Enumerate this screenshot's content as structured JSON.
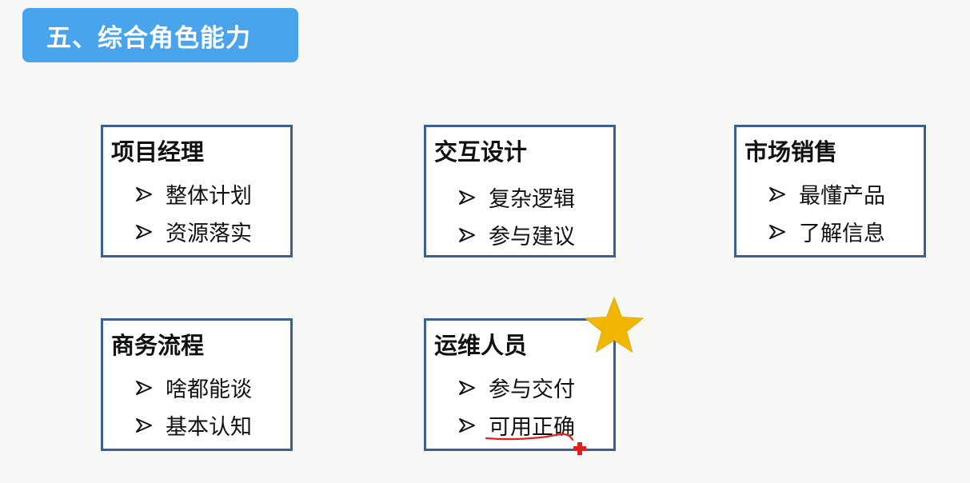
{
  "title": "五、综合角色能力",
  "cards": [
    {
      "title": "项目经理",
      "items": [
        "整体计划",
        "资源落实"
      ]
    },
    {
      "title": "交互设计",
      "items": [
        "复杂逻辑",
        "参与建议"
      ]
    },
    {
      "title": "市场销售",
      "items": [
        "最懂产品",
        "了解信息"
      ]
    },
    {
      "title": "商务流程",
      "items": [
        "啥都能谈",
        "基本认知"
      ]
    },
    {
      "title": "运维人员",
      "items": [
        "参与交付",
        "可用正确"
      ]
    }
  ],
  "colors": {
    "banner": "#4aa4ec",
    "card_border": "#3c5f92",
    "star": "#f2b705",
    "annotation": "#e0201c"
  },
  "icons": {
    "bullet": "arrowhead-bullet-icon",
    "star": "star-icon",
    "cursor": "red-plus-cursor-icon"
  }
}
